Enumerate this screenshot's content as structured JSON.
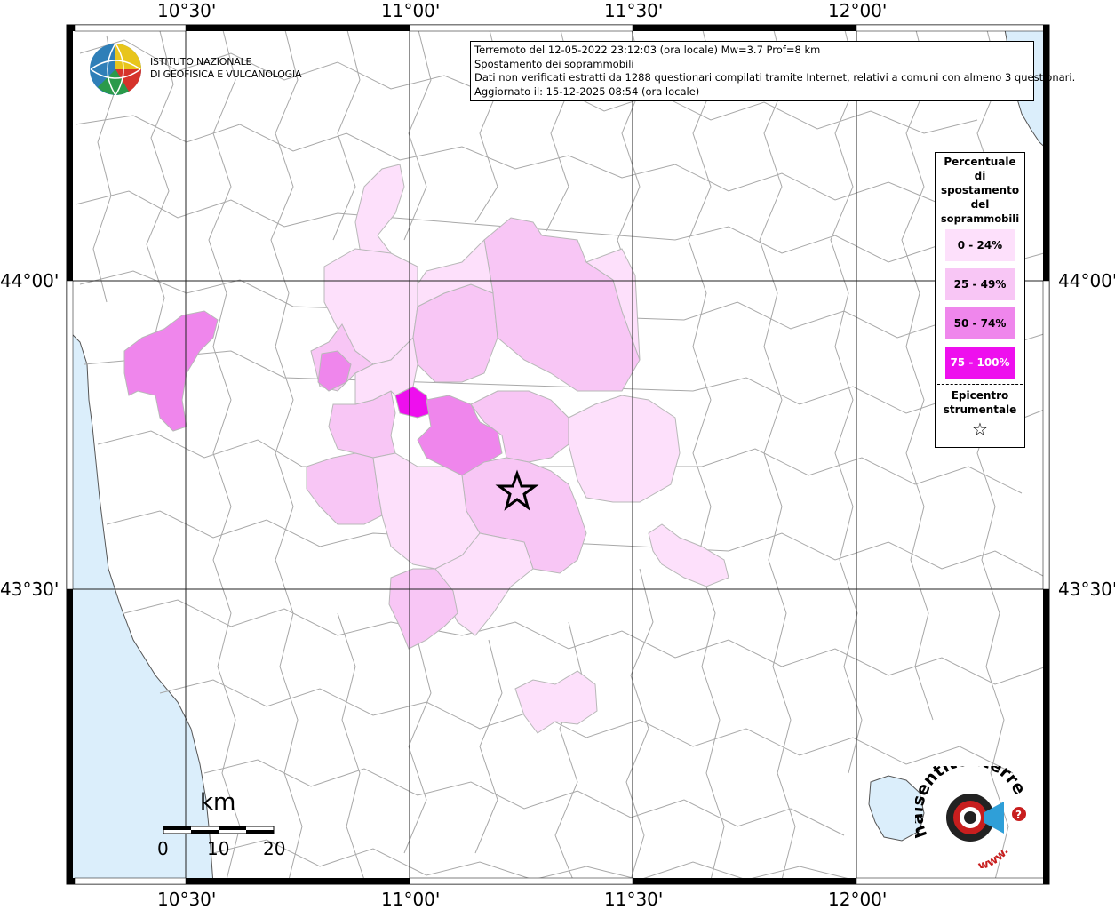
{
  "info": {
    "line1": "Terremoto del 12-05-2022 23:12:03 (ora locale) Mw=3.7 Prof=8 km",
    "line2": "Spostamento dei soprammobili",
    "line3": "Dati non verificati estratti da 1288 questionari compilati tramite Internet, relativi a comuni con almeno 3 questionari.",
    "line4": "Aggiornato il: 15-12-2025 08:54 (ora locale)"
  },
  "institute": {
    "line1": "ISTITUTO NAZIONALE",
    "line2": "DI GEOFISICA E VULCANOLOGIA"
  },
  "axes": {
    "top": [
      "10°30'",
      "11°00'",
      "11°30'",
      "12°00'"
    ],
    "bottom": [
      "10°30'",
      "11°00'",
      "11°30'",
      "12°00'"
    ],
    "left": [
      "44°00'",
      "43°30'"
    ],
    "right": [
      "44°00'",
      "43°30'"
    ]
  },
  "legend": {
    "title_lines": [
      "Percentuale",
      "di",
      "spostamento",
      "del",
      "soprammobili"
    ],
    "classes": [
      {
        "label": "0 - 24%",
        "color": "#fde0fb",
        "text_color": "#000000"
      },
      {
        "label": "25 - 49%",
        "color": "#f8c6f5",
        "text_color": "#000000"
      },
      {
        "label": "50 - 74%",
        "color": "#ef86ec",
        "text_color": "#000000"
      },
      {
        "label": "75 - 100%",
        "color": "#ee0fee",
        "text_color": "#ffffff"
      }
    ],
    "epicenter_lines": [
      "Epicentro",
      "strumentale"
    ],
    "epicenter_symbol": "☆"
  },
  "scale": {
    "unit": "km",
    "ticks": [
      "0",
      "10",
      "20"
    ]
  },
  "site_logo": {
    "text": "haisentitoilterremoto.it",
    "url_text": "www."
  },
  "colors": {
    "sea": "#dbeefb",
    "border": "#9a9a9a",
    "grid": "#000000"
  }
}
